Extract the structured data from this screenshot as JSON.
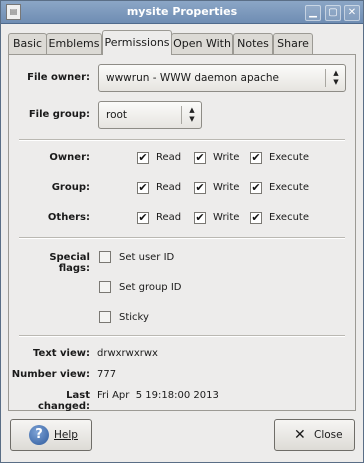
{
  "window": {
    "title": "mysite Properties"
  },
  "tabs": [
    {
      "label": "Basic"
    },
    {
      "label": "Emblems"
    },
    {
      "label": "Permissions"
    },
    {
      "label": "Open With"
    },
    {
      "label": "Notes"
    },
    {
      "label": "Share"
    }
  ],
  "active_tab": "Permissions",
  "file_owner": {
    "label": "File owner:",
    "value": "wwwrun - WWW daemon apache"
  },
  "file_group": {
    "label": "File group:",
    "value": "root"
  },
  "permissions": {
    "owner": {
      "label": "Owner:",
      "read": "Read",
      "write": "Write",
      "execute": "Execute"
    },
    "group": {
      "label": "Group:",
      "read": "Read",
      "write": "Write",
      "execute": "Execute"
    },
    "others": {
      "label": "Others:",
      "read": "Read",
      "write": "Write",
      "execute": "Execute"
    }
  },
  "special_flags": {
    "label": "Special flags:",
    "set_user_id": "Set user ID",
    "set_group_id": "Set group ID",
    "sticky": "Sticky"
  },
  "info": {
    "text_view_label": "Text view:",
    "text_view": "drwxrwxrwx",
    "number_view_label": "Number view:",
    "number_view": "777",
    "last_changed_label": "Last changed:",
    "last_changed": "Fri Apr  5 19:18:00 2013"
  },
  "buttons": {
    "help": "Help",
    "close": "Close"
  },
  "check_glyph": "✔"
}
